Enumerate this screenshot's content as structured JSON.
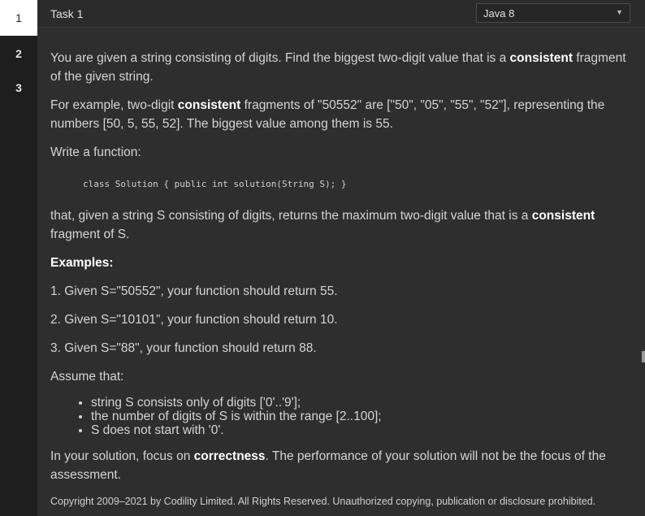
{
  "nav": {
    "items": [
      "1",
      "2",
      "3"
    ]
  },
  "header": {
    "task_title": "Task 1",
    "language": "Java 8"
  },
  "content": {
    "p1_a": "You are given a string consisting of digits. Find the biggest two-digit value that is a ",
    "p1_b": "consistent",
    "p1_c": " fragment of the given string.",
    "p2_a": "For example, two-digit ",
    "p2_b": "consistent",
    "p2_c": " fragments of \"50552\" are [\"50\", \"05\", \"55\", \"52\"], representing the numbers [50, 5, 55, 52]. The biggest value among them is 55.",
    "p3": "Write a function:",
    "code": "class Solution { public int solution(String S); }",
    "p4_a": "that, given a string S consisting of digits, returns the maximum two-digit value that is a ",
    "p4_b": "consistent",
    "p4_c": " fragment of S.",
    "examples_heading": "Examples:",
    "examples": [
      "1. Given S=\"50552\", your function should return 55.",
      "2. Given S=\"10101\", your function should return 10.",
      "3. Given S=\"88\", your function should return 88."
    ],
    "assume": "Assume that:",
    "bullets": [
      "string S consists only of digits ['0'..'9'];",
      "the number of digits of S is within the range [2..100];",
      "S does not start with '0'."
    ],
    "p5_a": "In your solution, focus on ",
    "p5_b": "correctness",
    "p5_c": ". The performance of your solution will not be the focus of the assessment."
  },
  "footer": {
    "copyright": "Copyright 2009–2021 by Codility Limited. All Rights Reserved. Unauthorized copying, publication or disclosure prohibited."
  }
}
